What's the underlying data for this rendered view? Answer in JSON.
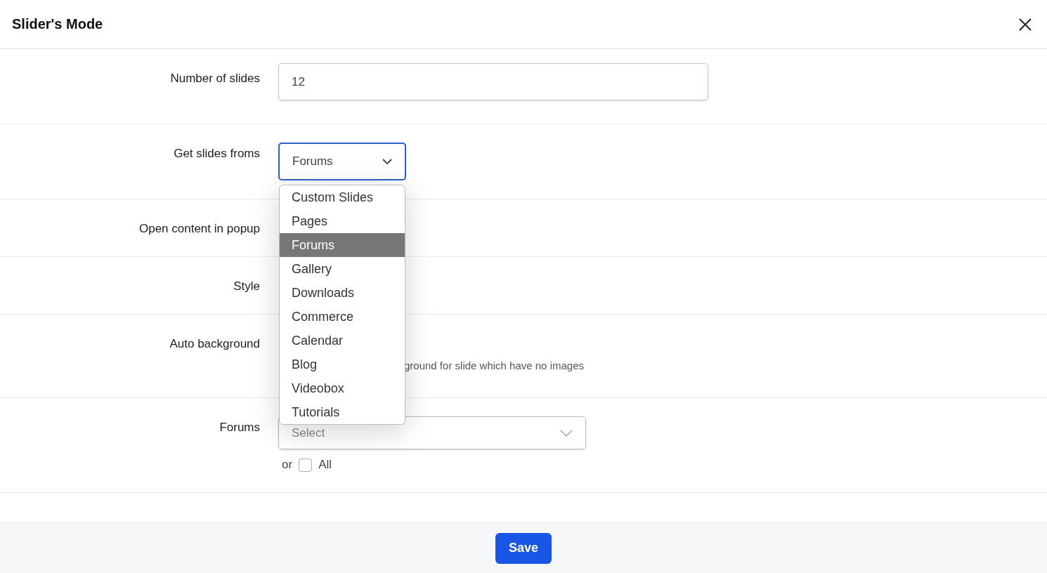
{
  "dialog": {
    "title": "Slider's Mode"
  },
  "fields": [
    {
      "kind": "text",
      "label": "Number of slides",
      "value": "12"
    },
    {
      "kind": "select",
      "label": "Get slides froms",
      "value": "Forums",
      "open": true
    },
    {
      "kind": "hidden",
      "label": "Open content in popup"
    },
    {
      "kind": "hidden",
      "label": "Style"
    },
    {
      "kind": "hint",
      "label": "Auto background",
      "hint": "ground for slide which have no images"
    },
    {
      "kind": "picker",
      "label": "Forums",
      "placeholder": "Select",
      "or_text": "or",
      "all_label": "All",
      "all_checked": false
    }
  ],
  "dropdown_options": [
    {
      "label": "Custom Slides",
      "selected": false
    },
    {
      "label": "Pages",
      "selected": false
    },
    {
      "label": "Forums",
      "selected": true
    },
    {
      "label": "Gallery",
      "selected": false
    },
    {
      "label": "Downloads",
      "selected": false
    },
    {
      "label": "Commerce",
      "selected": false
    },
    {
      "label": "Calendar",
      "selected": false
    },
    {
      "label": "Blog",
      "selected": false
    },
    {
      "label": "Videobox",
      "selected": false
    },
    {
      "label": "Tutorials",
      "selected": false
    }
  ],
  "footer": {
    "button": "Save"
  }
}
